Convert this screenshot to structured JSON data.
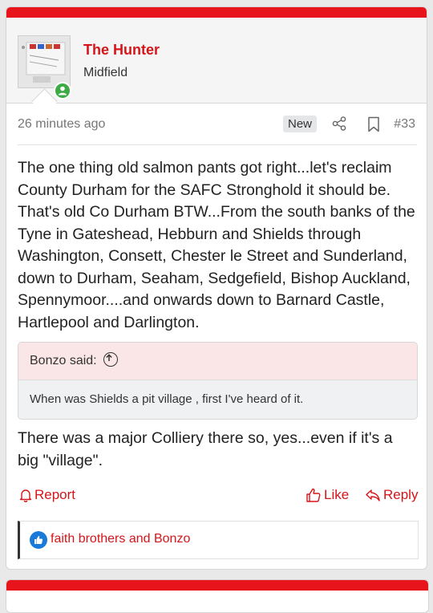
{
  "post": {
    "username": "The Hunter",
    "user_title": "Midfield",
    "time": "26 minutes ago",
    "badge": "New",
    "post_number": "#33",
    "body": "The one thing old salmon pants got right...let's reclaim County Durham for the SAFC Stronghold it should be. That's old Co Durham BTW...From the south banks of the Tyne in Gateshead, Hebburn and Shields through Washington, Consett, Chester le Street and Sunderland, down to Durham, Seaham, Sedgefield, Bishop Auckland, Spennymoor....and onwards down to Barnard Castle, Hartlepool and Darlington.",
    "quote": {
      "author": "Bonzo said:",
      "text": "When was Shields a pit village , first I've heard of it."
    },
    "reply": "There was a major Colliery there so, yes...even if it's a big \"village\".",
    "actions": {
      "report": "Report",
      "like": "Like",
      "reply": "Reply"
    },
    "reactions": "faith brothers and Bonzo"
  },
  "colors": {
    "brand_red": "#e8141c",
    "link_red": "#d61519",
    "online_green": "#3cab45",
    "like_blue": "#1a7ad9"
  },
  "icons": [
    "online-status-icon",
    "share-icon",
    "bookmark-icon",
    "quote-arrow-icon",
    "report-icon",
    "like-icon",
    "reply-icon",
    "like-reaction-icon"
  ]
}
